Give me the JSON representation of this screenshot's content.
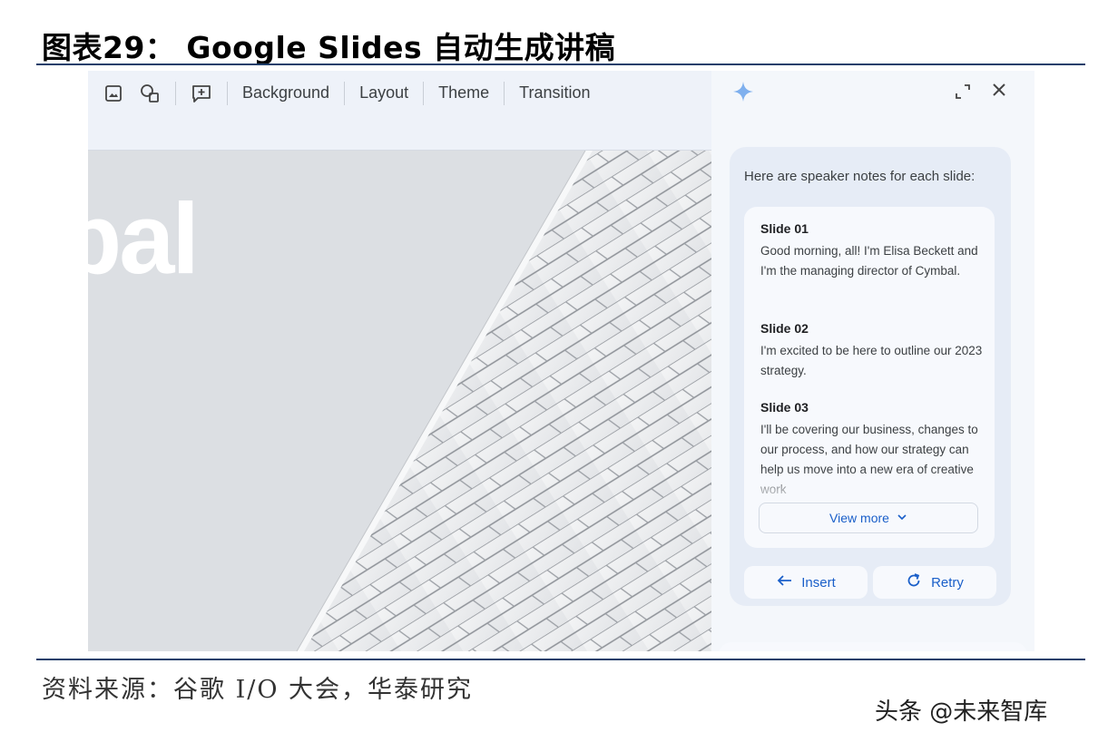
{
  "report": {
    "figure_title": "图表29： Google Slides 自动生成讲稿",
    "source": "资料来源：谷歌 I/O 大会，华泰研究",
    "watermark": "头条 @未来智库"
  },
  "toolbar": {
    "icons": [
      "image-icon",
      "shapes-icon",
      "add-comment-icon"
    ],
    "buttons": [
      "Background",
      "Layout",
      "Theme",
      "Transition"
    ]
  },
  "slide": {
    "partial_text": "bal"
  },
  "panel": {
    "header_icons": [
      "sparkle-icon",
      "expand-icon",
      "close-icon"
    ],
    "intro": "Here are speaker notes for each slide:",
    "notes": [
      {
        "title": "Slide 01",
        "body": "Good morning, all! I'm Elisa Beckett and I'm the managing director of Cymbal."
      },
      {
        "title": "Slide 02",
        "body": "I'm excited to be here to outline our 2023 strategy."
      },
      {
        "title": "Slide 03",
        "body": "I'll be covering our business, changes to our process, and how our strategy can help us move into a new era of creative work"
      }
    ],
    "view_more": "View more",
    "insert": "Insert",
    "retry": "Retry"
  },
  "colors": {
    "rule": "#1f3f6b",
    "accent": "#1a5fc9",
    "panel_bg": "#f4f7fb",
    "canvas_bg": "#dfe2e6"
  }
}
